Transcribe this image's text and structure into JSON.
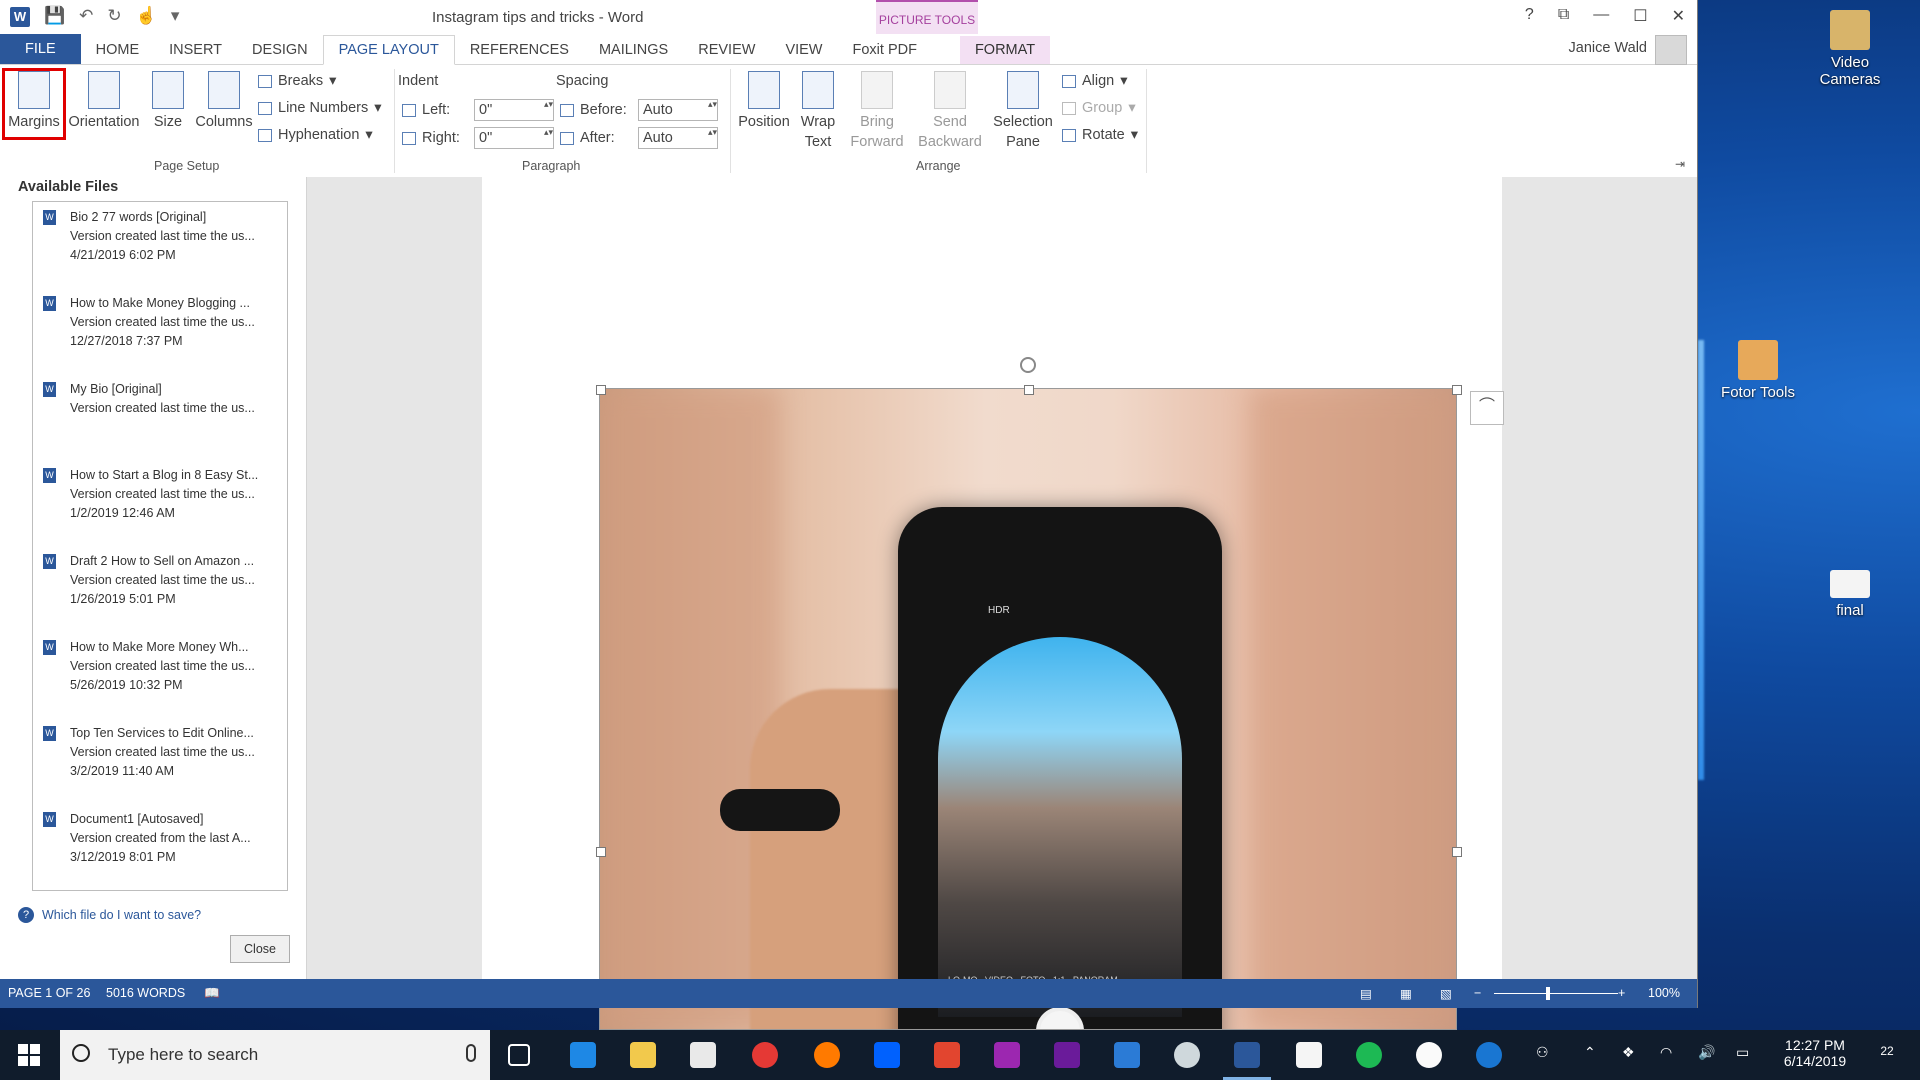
{
  "window": {
    "title": "Instagram tips and tricks - Word",
    "context_group": "PICTURE TOOLS",
    "user": "Janice Wald"
  },
  "tabs": [
    "FILE",
    "HOME",
    "INSERT",
    "DESIGN",
    "PAGE LAYOUT",
    "REFERENCES",
    "MAILINGS",
    "REVIEW",
    "VIEW",
    "Foxit PDF",
    "FORMAT"
  ],
  "ribbon": {
    "page_setup": {
      "margins": "Margins",
      "orientation": "Orientation",
      "size": "Size",
      "columns": "Columns",
      "breaks": "Breaks",
      "line_numbers": "Line Numbers",
      "hyphenation": "Hyphenation",
      "label": "Page Setup"
    },
    "paragraph": {
      "indent": "Indent",
      "spacing": "Spacing",
      "left_label": "Left:",
      "left_value": "0\"",
      "right_label": "Right:",
      "right_value": "0\"",
      "before_label": "Before:",
      "before_value": "Auto",
      "after_label": "After:",
      "after_value": "Auto",
      "label": "Paragraph"
    },
    "arrange": {
      "position": "Position",
      "wrap1": "Wrap",
      "wrap2": "Text",
      "bring1": "Bring",
      "bring2": "Forward",
      "send1": "Send",
      "send2": "Backward",
      "sel1": "Selection",
      "sel2": "Pane",
      "align": "Align",
      "group": "Group",
      "rotate": "Rotate",
      "label": "Arrange"
    }
  },
  "files_panel": {
    "title": "Available Files",
    "items": [
      {
        "name": "Bio 2 77 words  [Original]",
        "desc": "Version created last time the us...",
        "date": "4/21/2019 6:02 PM"
      },
      {
        "name": "How to Make Money Blogging ...",
        "desc": "Version created last time the us...",
        "date": "12/27/2018 7:37 PM"
      },
      {
        "name": "My Bio  [Original]",
        "desc": "Version created last time the us...",
        "date": ""
      },
      {
        "name": "How to Start a Blog in 8 Easy St...",
        "desc": "Version created last time the us...",
        "date": "1/2/2019 12:46 AM"
      },
      {
        "name": "Draft 2 How to Sell on Amazon ...",
        "desc": "Version created last time the us...",
        "date": "1/26/2019 5:01 PM"
      },
      {
        "name": "How to Make More Money Wh...",
        "desc": "Version created last time the us...",
        "date": "5/26/2019 10:32 PM"
      },
      {
        "name": "Top Ten Services to Edit Online...",
        "desc": "Version created last time the us...",
        "date": "3/2/2019 11:40 AM"
      },
      {
        "name": "Document1  [Autosaved]",
        "desc": "Version created from the last A...",
        "date": "3/12/2019 8:01 PM"
      }
    ],
    "help": "Which file do I want to save?",
    "close": "Close"
  },
  "phone_ui": {
    "modes": "LO-MO   VIDEO   FOTO   1:1   PANORAM",
    "hdr": "HDR"
  },
  "status": {
    "page": "PAGE 1 OF 26",
    "words": "5016 WORDS",
    "zoom": "100%",
    "zoom_level": 1.0
  },
  "desktop": {
    "icons": [
      "Video Cameras",
      "Fotor Tools",
      "final"
    ]
  },
  "taskbar": {
    "search_placeholder": "Type here to search",
    "time": "12:27 PM",
    "date": "6/14/2019",
    "notifications": "22"
  }
}
